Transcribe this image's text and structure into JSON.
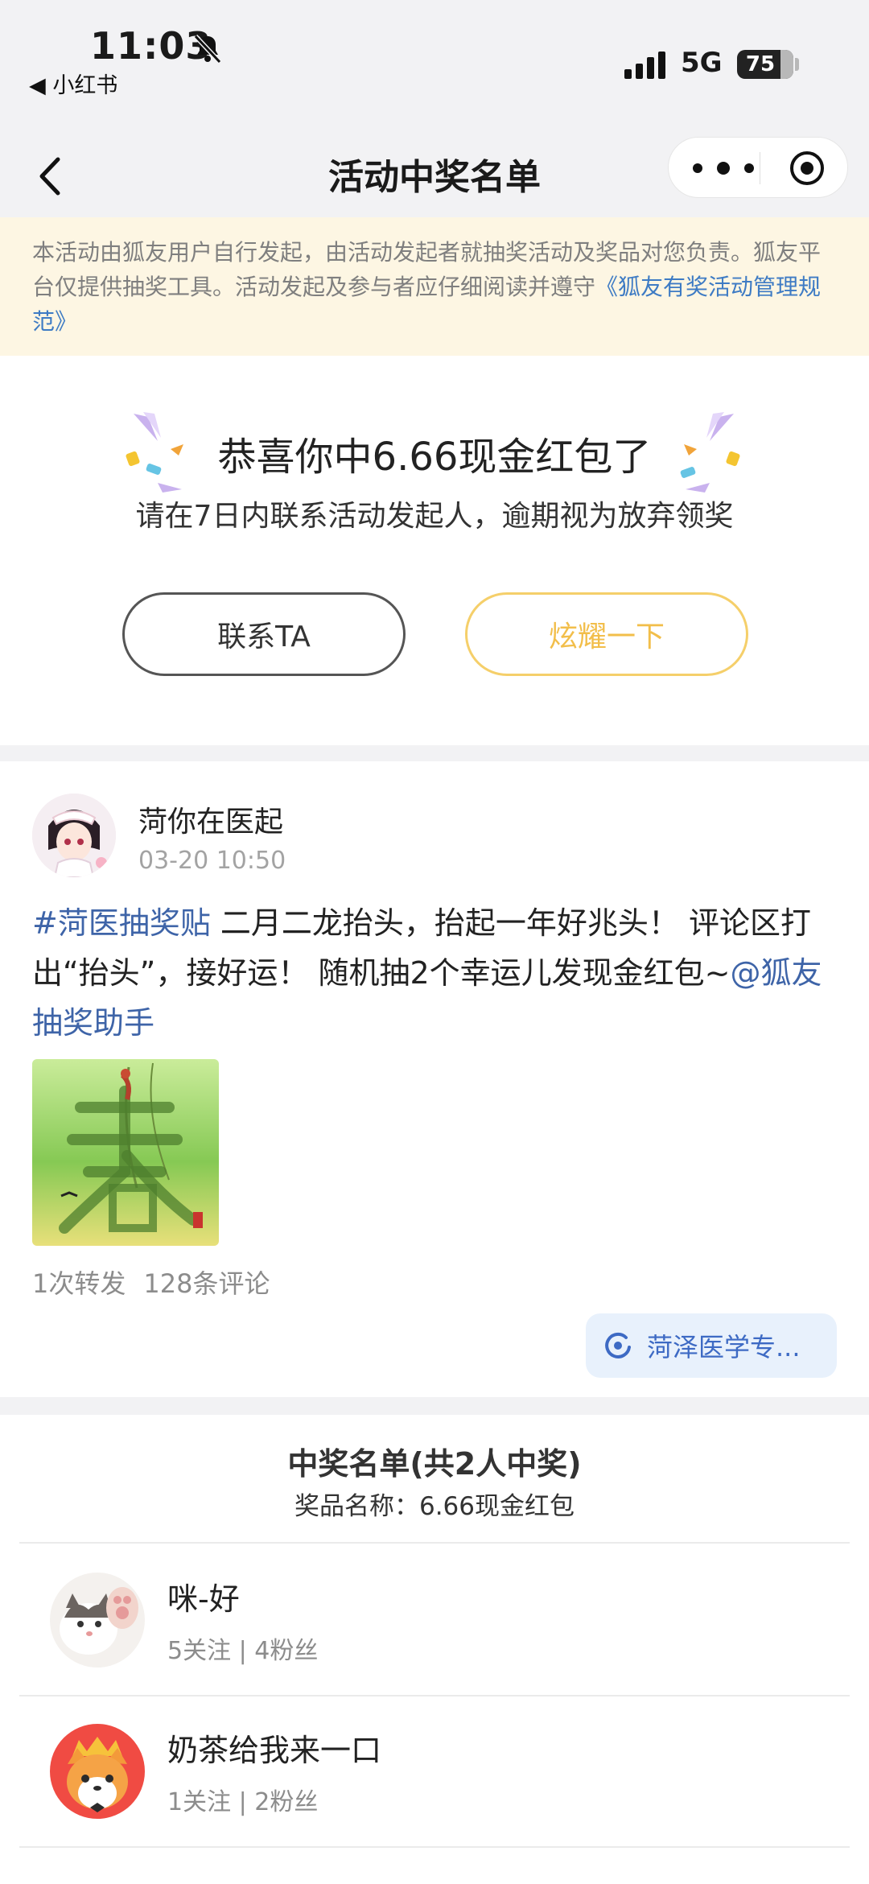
{
  "status_bar": {
    "time": "11:03",
    "back_app": "◀ 小红书",
    "network": "5G",
    "battery": "75"
  },
  "nav": {
    "title": "活动中奖名单"
  },
  "notice": {
    "text": "本活动由狐友用户自行发起，由活动发起者就抽奖活动及奖品对您负责。狐友平台仅提供抽奖工具。活动发起及参与者应仔细阅读并遵守",
    "link": "《狐友有奖活动管理规范》"
  },
  "congrats": {
    "title": "恭喜你中6.66现金红包了",
    "subtitle": "请在7日内联系活动发起人，逾期视为放弃领奖",
    "contact_label": "联系TA",
    "show_label": "炫耀一下"
  },
  "post": {
    "author": "菏你在医起",
    "time": "03-20 10:50",
    "hashtag": "#菏医抽奖贴",
    "body": " 二月二龙抬头，抬起一年好兆头！ 评论区打出“抬头”，接好运！ 随机抽2个幸运儿发现金红包~",
    "mention": "@狐友抽奖助手",
    "reposts": "1次转发",
    "comments": "128条评论",
    "source": "菏泽医学专..."
  },
  "winners": {
    "title": "中奖名单(共2人中奖)",
    "prize": "奖品名称：6.66现金红包",
    "list": [
      {
        "name": "咪-好",
        "stats": "5关注 | 4粉丝"
      },
      {
        "name": "奶茶给我来一口",
        "stats": "1关注 | 2粉丝"
      }
    ]
  },
  "colors": {
    "link": "#3e7bc4",
    "hashtag": "#3e64a8",
    "notice_bg": "#fdf6e3",
    "show_button": "#f2be4a",
    "source_chip_bg": "#e8f1fc"
  }
}
